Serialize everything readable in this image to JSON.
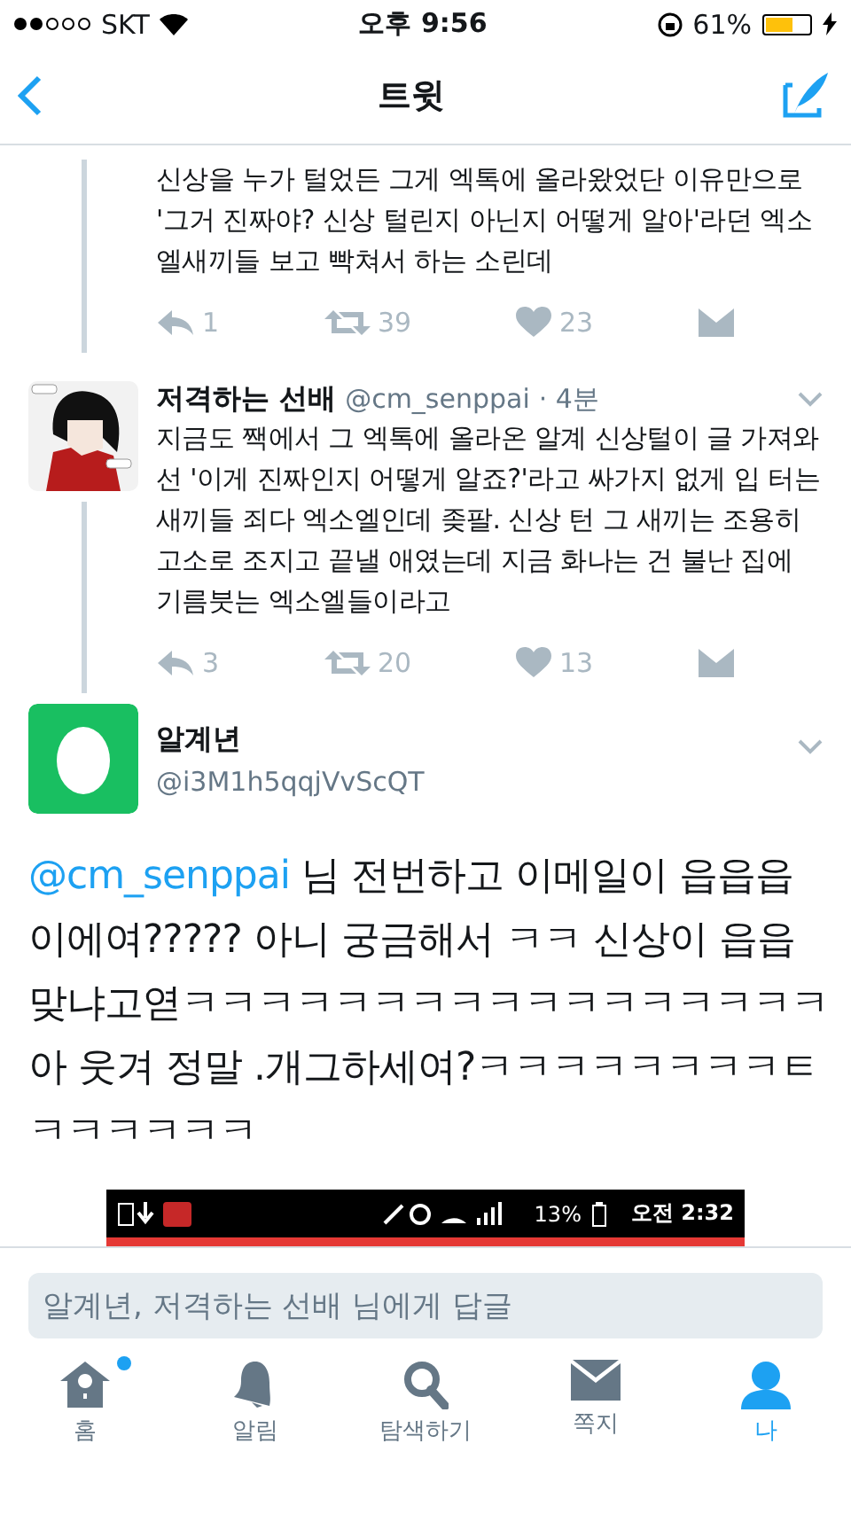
{
  "status_bar": {
    "carrier": "SKT",
    "time": "오후 9:56",
    "battery": "61%"
  },
  "nav": {
    "title": "트윗"
  },
  "tweets": [
    {
      "kind": "continuation",
      "text": "신상을 누가 털었든 그게 엑톡에 올라왔었단 이유만으로 '그거 진짜야? 신상 털린지 아닌지 어떻게 알아'라던 엑소엘새끼들 보고 빡쳐서 하는 소린데",
      "replies": "1",
      "retweets": "39",
      "likes": "23"
    },
    {
      "kind": "reply",
      "name": "저격하는 선배",
      "handle": "@cm_senppai",
      "time": "· 4분",
      "text": "지금도 짹에서 그 엑톡에 올라온 알계 신상털이 글 가져와선 '이게 진짜인지 어떻게 알죠?'라고 싸가지 없게 입 터는 새끼들 죄다 엑소엘인데 좆팔. 신상 턴 그 새끼는 조용히 고소로 조지고 끝낼 애였는데 지금 화나는 건 불난 집에 기름붓는 엑소엘들이라고",
      "replies": "3",
      "retweets": "20",
      "likes": "13"
    }
  ],
  "main_tweet": {
    "name": "알계년",
    "handle": "@i3M1h5qqjVvScQT",
    "mention": "@cm_senppai",
    "text": " 님 전번하고 이메일이 읍읍읍이에여????? 아니 궁금해서 ㅋㅋ 신상이 읍읍맞냐고엳ㅋㅋㅋㅋㅋㅋㅋㅋㅋㅋㅋㅋㅋㅋㅋㅋㅋ아 웃겨 정말 .개그하세여?ㅋㅋㅋㅋㅋㅋㅋㅋㅌㅋㅋㅋㅋㅋㅋ",
    "attached_screenshot": {
      "battery": "13%",
      "time": "오전 2:32"
    }
  },
  "reply_field": {
    "placeholder": "알계년, 저격하는 선배 님에게 답글"
  },
  "tabs": [
    {
      "kind": "home",
      "label": "홈",
      "selected": false,
      "badge": true
    },
    {
      "kind": "bell",
      "label": "알림",
      "selected": false,
      "badge": false
    },
    {
      "kind": "search",
      "label": "탐색하기",
      "selected": false,
      "badge": false
    },
    {
      "kind": "mail",
      "label": "쪽지",
      "selected": false,
      "badge": false
    },
    {
      "kind": "person",
      "label": "나",
      "selected": true,
      "badge": false
    }
  ]
}
